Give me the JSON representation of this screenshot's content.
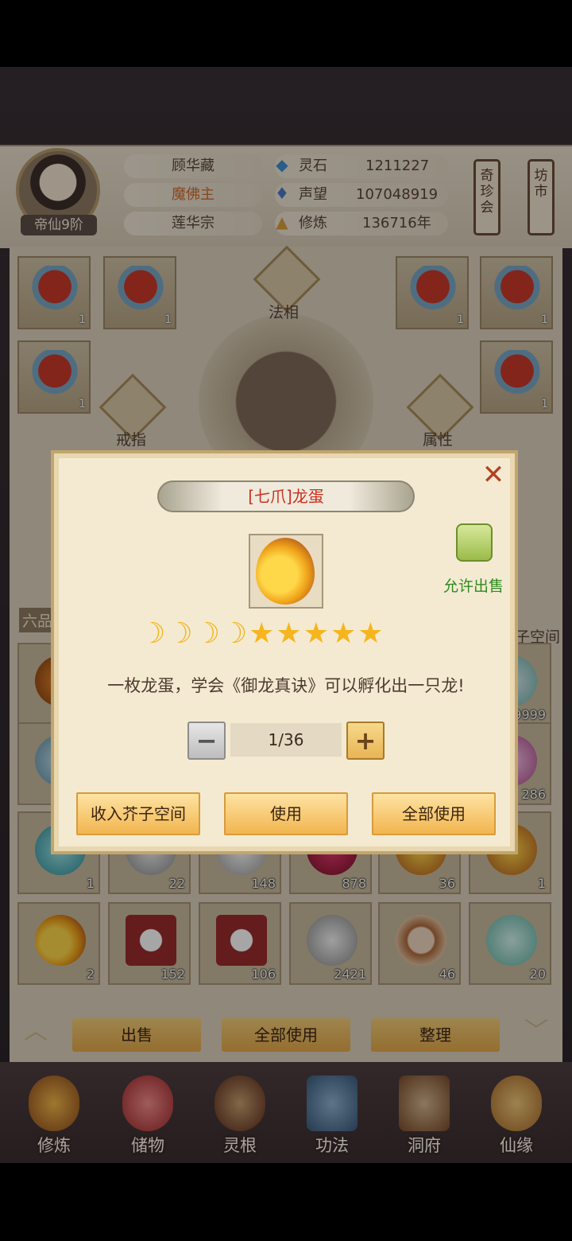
{
  "player": {
    "rank": "帝仙9阶",
    "name": "顾华藏",
    "title": "魔佛主",
    "sect": "莲华宗"
  },
  "stats": [
    {
      "label": "灵石",
      "value": "1211227",
      "icon": "spirit-stone-icon"
    },
    {
      "label": "声望",
      "value": "107048919",
      "icon": "prestige-icon"
    },
    {
      "label": "修炼",
      "value": "136716年",
      "icon": "cultivation-icon"
    }
  ],
  "banners": {
    "left": "奇珍会",
    "right": "坊市"
  },
  "equip": {
    "faxiang": "法相",
    "ring": "戒指",
    "attribute": "属性",
    "slot_count": "1"
  },
  "partial_labels": {
    "tier": "六品",
    "space": "子空间"
  },
  "grid_counts": {
    "row1": [
      "",
      "",
      "",
      "",
      "",
      "9999"
    ],
    "row2": [
      "",
      "",
      "",
      "",
      "",
      "286"
    ],
    "row3": [
      "1",
      "22",
      "148",
      "878",
      "36",
      "1"
    ],
    "row4": [
      "2",
      "152",
      "106",
      "2421",
      "46",
      "20"
    ]
  },
  "actions": {
    "sell": "出售",
    "use_all": "全部使用",
    "sort": "整理"
  },
  "nav": [
    {
      "label": "修炼",
      "icon": "cultivate-icon"
    },
    {
      "label": "储物",
      "icon": "storage-bag-icon"
    },
    {
      "label": "灵根",
      "icon": "spirit-root-icon"
    },
    {
      "label": "功法",
      "icon": "technique-book-icon"
    },
    {
      "label": "洞府",
      "icon": "cave-dwelling-icon"
    },
    {
      "label": "仙缘",
      "icon": "fortune-gourd-icon"
    }
  ],
  "modal": {
    "title": "[七爪]龙蛋",
    "sell_label": "允许出售",
    "moons": 4,
    "stars": 5,
    "description": "一枚龙蛋，学会《御龙真诀》可以孵化出一只龙!",
    "quantity": "1/36",
    "buttons": {
      "store": "收入芥子空间",
      "use": "使用",
      "use_all": "全部使用"
    }
  },
  "colors": {
    "title_red": "#cc2f1f",
    "sell_green": "#2e8b1e",
    "gold": "#f2b54f"
  }
}
